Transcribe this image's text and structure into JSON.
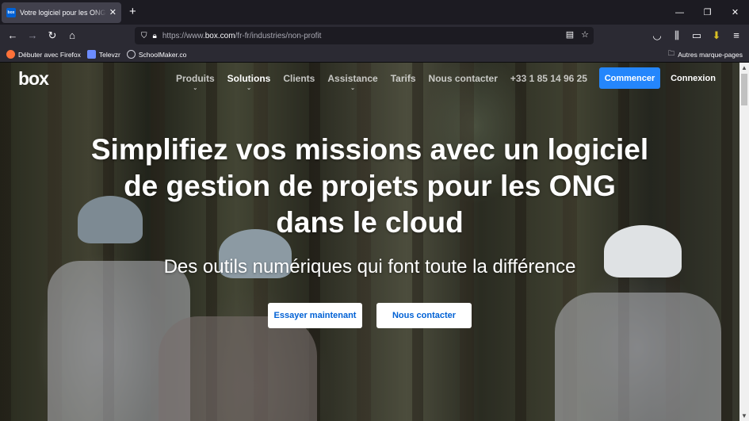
{
  "browser": {
    "tab": {
      "title": "Votre logiciel pour les ONG dans le cloud",
      "favicon_text": "box"
    },
    "url": {
      "prefix": "https://www.",
      "domain": "box.com",
      "path": "/fr-fr/industries/non-profit"
    },
    "bookmarks": [
      {
        "label": "Débuter avec Firefox",
        "color": "#ff7139"
      },
      {
        "label": "Televzr",
        "color": "#6c8cff"
      },
      {
        "label": "SchoolMaker.co",
        "color": "#cfcfd8"
      }
    ],
    "bookmarks_other": "Autres marque-pages"
  },
  "site": {
    "logo": "box",
    "menu": [
      {
        "label": "Produits",
        "has_caret": true,
        "active": false
      },
      {
        "label": "Solutions",
        "has_caret": true,
        "active": true
      },
      {
        "label": "Clients",
        "has_caret": false,
        "active": false
      },
      {
        "label": "Assistance",
        "has_caret": true,
        "active": false
      },
      {
        "label": "Tarifs",
        "has_caret": false,
        "active": false
      },
      {
        "label": "Nous contacter",
        "has_caret": false,
        "active": false
      },
      {
        "label": "+33 1 85 14 96 25",
        "has_caret": false,
        "active": false
      }
    ],
    "cta_start": "Commencer",
    "cta_login": "Connexion",
    "hero": {
      "title_line1": "Simplifiez vos missions avec un logiciel",
      "title_line2": "de gestion de projets pour les ONG",
      "title_line3": "dans le cloud",
      "subtitle": "Des outils numériques qui font toute la différence",
      "btn_try": "Essayer maintenant",
      "btn_contact": "Nous contacter"
    },
    "colors": {
      "primary": "#2486fc",
      "button_text": "#0061d5"
    }
  }
}
